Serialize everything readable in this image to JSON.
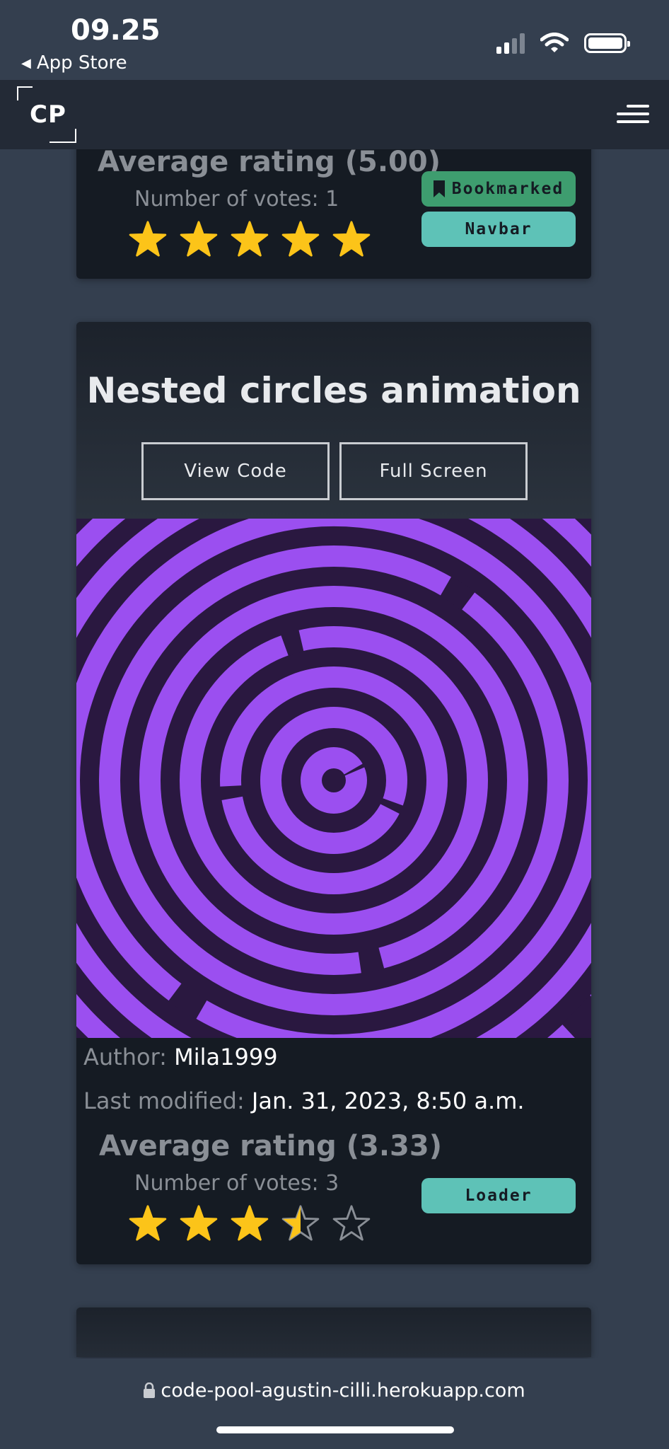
{
  "status_bar": {
    "time": "09.25",
    "back_label": "App Store"
  },
  "navbar": {
    "logo_text": "CP"
  },
  "cards": [
    {
      "average_rating": "Average rating (5.00)",
      "votes": "Number of votes: 1",
      "rating_value": 5.0,
      "tags": [
        "Bookmarked",
        "Navbar"
      ]
    },
    {
      "title": "Nested circles animation",
      "view_code_label": "View Code",
      "full_screen_label": "Full Screen",
      "author_label": "Author:",
      "author_value": "Mila1999",
      "modified_label": "Last modified:",
      "modified_value": "Jan. 31, 2023, 8:50 a.m.",
      "average_rating": "Average rating (3.33)",
      "votes": "Number of votes: 3",
      "rating_value": 3.33,
      "tags": [
        "Loader"
      ]
    }
  ],
  "browser": {
    "url": "code-pool-agustin-cilli.herokuapp.com"
  },
  "colors": {
    "page_bg": "#343f4f",
    "card_bg": "#151b23",
    "star_gold": "#fcc419",
    "preview_purple": "#9b4ff0",
    "preview_dark": "#2a1840",
    "tag_green": "#3e9d6f",
    "tag_teal": "#5ec2b7"
  },
  "icons": {
    "back": "triangle-left-icon",
    "signal": "cellular-signal-icon",
    "wifi": "wifi-icon",
    "battery": "battery-icon",
    "menu": "hamburger-menu-icon",
    "bookmark": "bookmark-icon",
    "star": "star-icon",
    "lock": "lock-icon"
  }
}
